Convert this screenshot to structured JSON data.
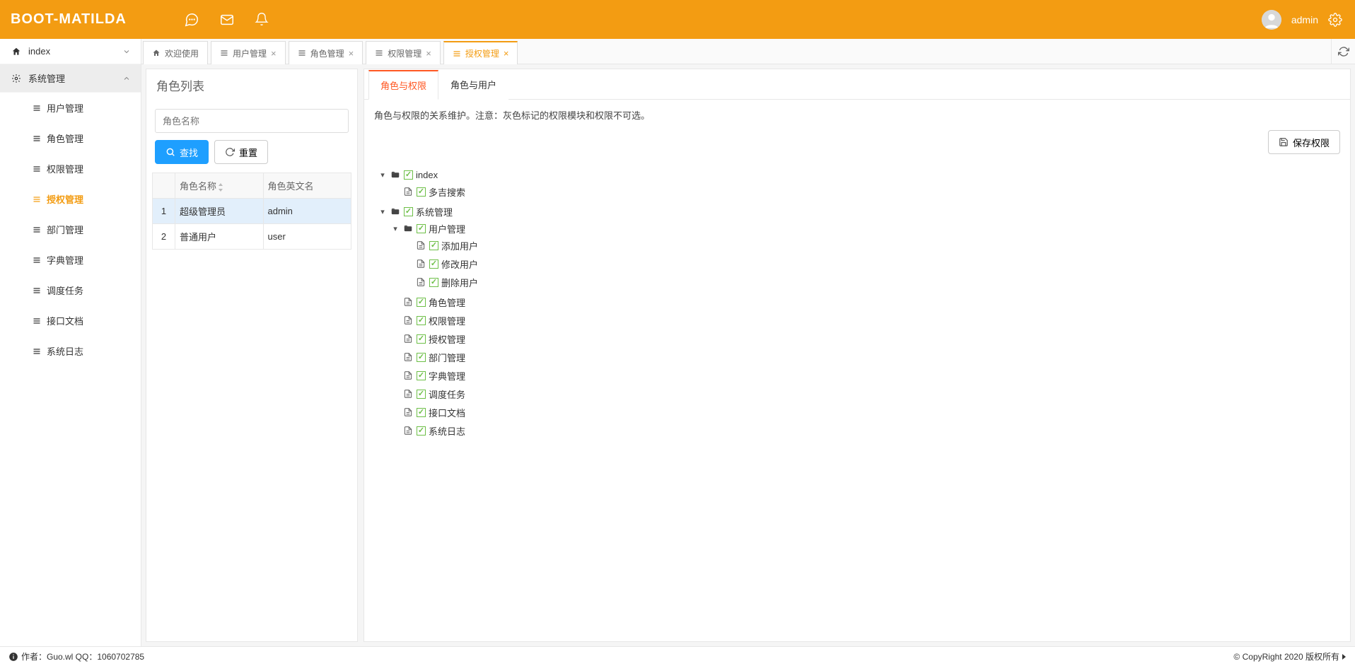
{
  "brand": "BOOT-MATILDA",
  "header": {
    "username": "admin"
  },
  "sidebar": {
    "top": {
      "label": "index"
    },
    "group": {
      "label": "系统管理"
    },
    "items": [
      {
        "label": "用户管理"
      },
      {
        "label": "角色管理"
      },
      {
        "label": "权限管理"
      },
      {
        "label": "授权管理"
      },
      {
        "label": "部门管理"
      },
      {
        "label": "字典管理"
      },
      {
        "label": "调度任务"
      },
      {
        "label": "接口文档"
      },
      {
        "label": "系统日志"
      }
    ]
  },
  "tabs": [
    {
      "label": "欢迎使用",
      "icon": "home",
      "closable": false
    },
    {
      "label": "用户管理",
      "icon": "menu",
      "closable": true
    },
    {
      "label": "角色管理",
      "icon": "menu",
      "closable": true
    },
    {
      "label": "权限管理",
      "icon": "menu",
      "closable": true
    },
    {
      "label": "授权管理",
      "icon": "menu",
      "closable": true
    }
  ],
  "left_pane": {
    "title": "角色列表",
    "search_placeholder": "角色名称",
    "search_btn": "查找",
    "reset_btn": "重置",
    "cols": {
      "idx": "",
      "name": "角色名称",
      "en": "角色英文名"
    },
    "rows": [
      {
        "idx": "1",
        "name": "超级管理员",
        "en": "admin"
      },
      {
        "idx": "2",
        "name": "普通用户",
        "en": "user"
      }
    ]
  },
  "right_pane": {
    "subtabs": [
      {
        "label": "角色与权限"
      },
      {
        "label": "角色与用户"
      }
    ],
    "desc": "角色与权限的关系维护。注意：灰色标记的权限模块和权限不可选。",
    "save_btn": "保存权限",
    "tree": [
      {
        "label": "index",
        "type": "folder",
        "open": true,
        "children": [
          {
            "label": "多吉搜索",
            "type": "file"
          }
        ]
      },
      {
        "label": "系统管理",
        "type": "folder",
        "open": true,
        "children": [
          {
            "label": "用户管理",
            "type": "folder",
            "open": true,
            "children": [
              {
                "label": "添加用户",
                "type": "file"
              },
              {
                "label": "修改用户",
                "type": "file"
              },
              {
                "label": "删除用户",
                "type": "file"
              }
            ]
          },
          {
            "label": "角色管理",
            "type": "file"
          },
          {
            "label": "权限管理",
            "type": "file"
          },
          {
            "label": "授权管理",
            "type": "file"
          },
          {
            "label": "部门管理",
            "type": "file"
          },
          {
            "label": "字典管理",
            "type": "file"
          },
          {
            "label": "调度任务",
            "type": "file"
          },
          {
            "label": "接口文档",
            "type": "file"
          },
          {
            "label": "系统日志",
            "type": "file"
          }
        ]
      }
    ]
  },
  "footer": {
    "left": "作者：Guo.wl  QQ：1060702785",
    "right": "© CopyRight 2020 版权所有"
  }
}
